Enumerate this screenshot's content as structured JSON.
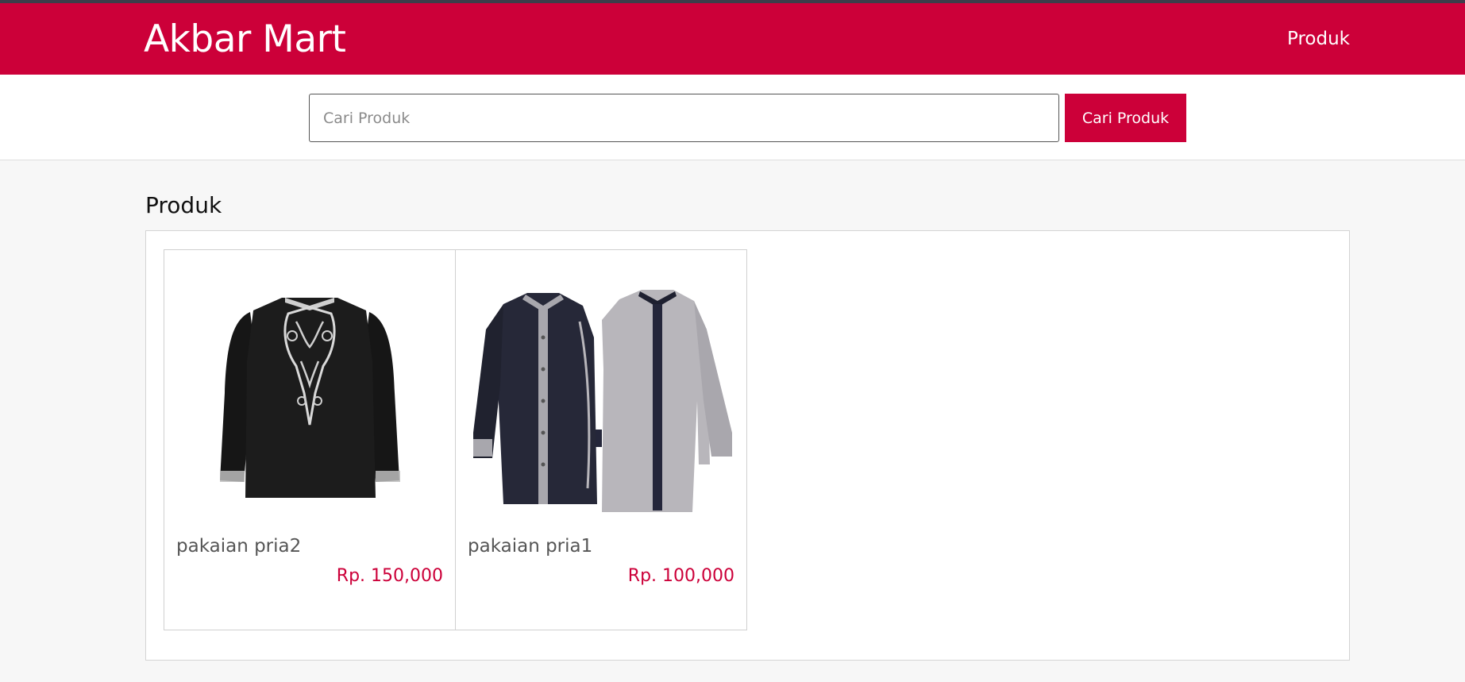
{
  "header": {
    "brand": "Akbar Mart",
    "nav_link": "Produk"
  },
  "search": {
    "placeholder": "Cari Produk",
    "value": "",
    "button_label": "Cari Produk"
  },
  "section": {
    "title": "Produk"
  },
  "products": [
    {
      "name": "pakaian pria2",
      "price": "Rp. 150,000",
      "image": "black-embroidered-shirt"
    },
    {
      "name": "pakaian pria1",
      "price": "Rp. 100,000",
      "image": "two-contrast-shirts"
    }
  ],
  "colors": {
    "brand": "#cc0039",
    "page_bg": "#f7f7f7"
  }
}
